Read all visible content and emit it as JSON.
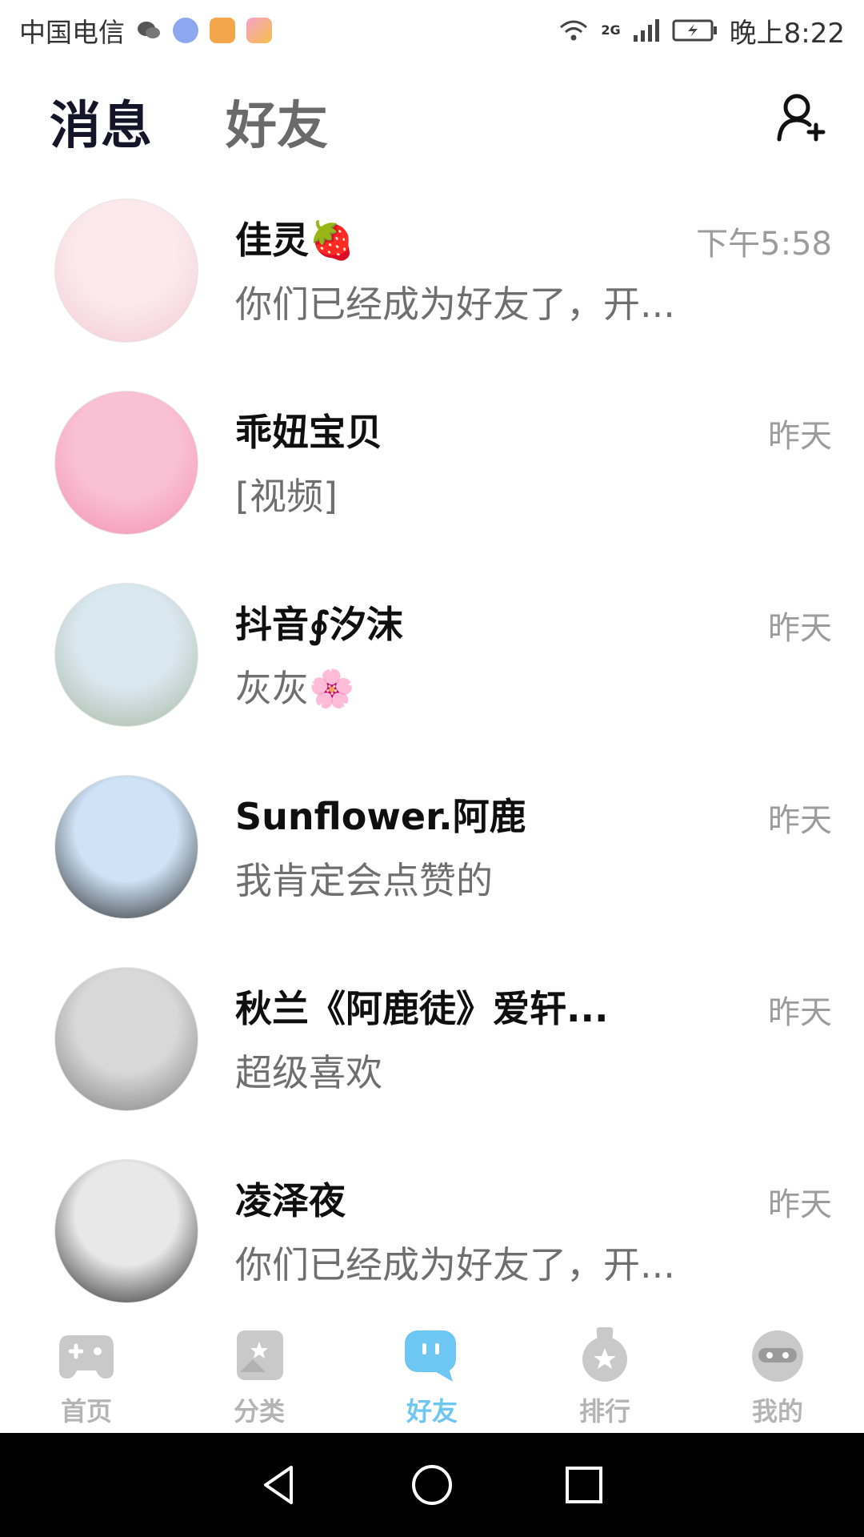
{
  "status_bar": {
    "carrier": "中国电信",
    "time": "晚上8:22",
    "network": "2G"
  },
  "header": {
    "tab_messages": "消息",
    "tab_friends": "好友"
  },
  "conversations": [
    {
      "name": "佳灵🍓",
      "time": "下午5:58",
      "preview": "你们已经成为好友了，开...",
      "avatar_colors": [
        "#fbe9ee",
        "#f4c9d6"
      ]
    },
    {
      "name": "乖妞宝贝",
      "time": "昨天",
      "preview": "[视频]",
      "avatar_colors": [
        "#f9c2d4",
        "#f48fb1"
      ]
    },
    {
      "name": "抖音∮汐沫",
      "time": "昨天",
      "preview": "灰灰🌸",
      "avatar_colors": [
        "#d9e7ef",
        "#a5b7a0"
      ]
    },
    {
      "name": "Sunflower.阿鹿",
      "time": "昨天",
      "preview": "我肯定会点赞的",
      "avatar_colors": [
        "#cfe3f7",
        "#202020"
      ]
    },
    {
      "name": "秋兰《阿鹿徒》爱轩...",
      "time": "昨天",
      "preview": "超级喜欢",
      "avatar_colors": [
        "#d8d8d8",
        "#7a7a7a"
      ]
    },
    {
      "name": "凌泽夜",
      "time": "昨天",
      "preview": "你们已经成为好友了，开...",
      "avatar_colors": [
        "#e8e8e8",
        "#1c1c1c"
      ]
    }
  ],
  "tabbar": {
    "items": [
      {
        "label": "首页",
        "icon": "gamepad-icon",
        "active": false
      },
      {
        "label": "分类",
        "icon": "category-icon",
        "active": false
      },
      {
        "label": "好友",
        "icon": "chat-bubble-icon",
        "active": true
      },
      {
        "label": "排行",
        "icon": "ranking-icon",
        "active": false
      },
      {
        "label": "我的",
        "icon": "profile-icon",
        "active": false
      }
    ]
  },
  "colors": {
    "accent": "#6ec6f3",
    "inactive_tab": "#b4b4b4",
    "title_dark": "#15152a"
  }
}
